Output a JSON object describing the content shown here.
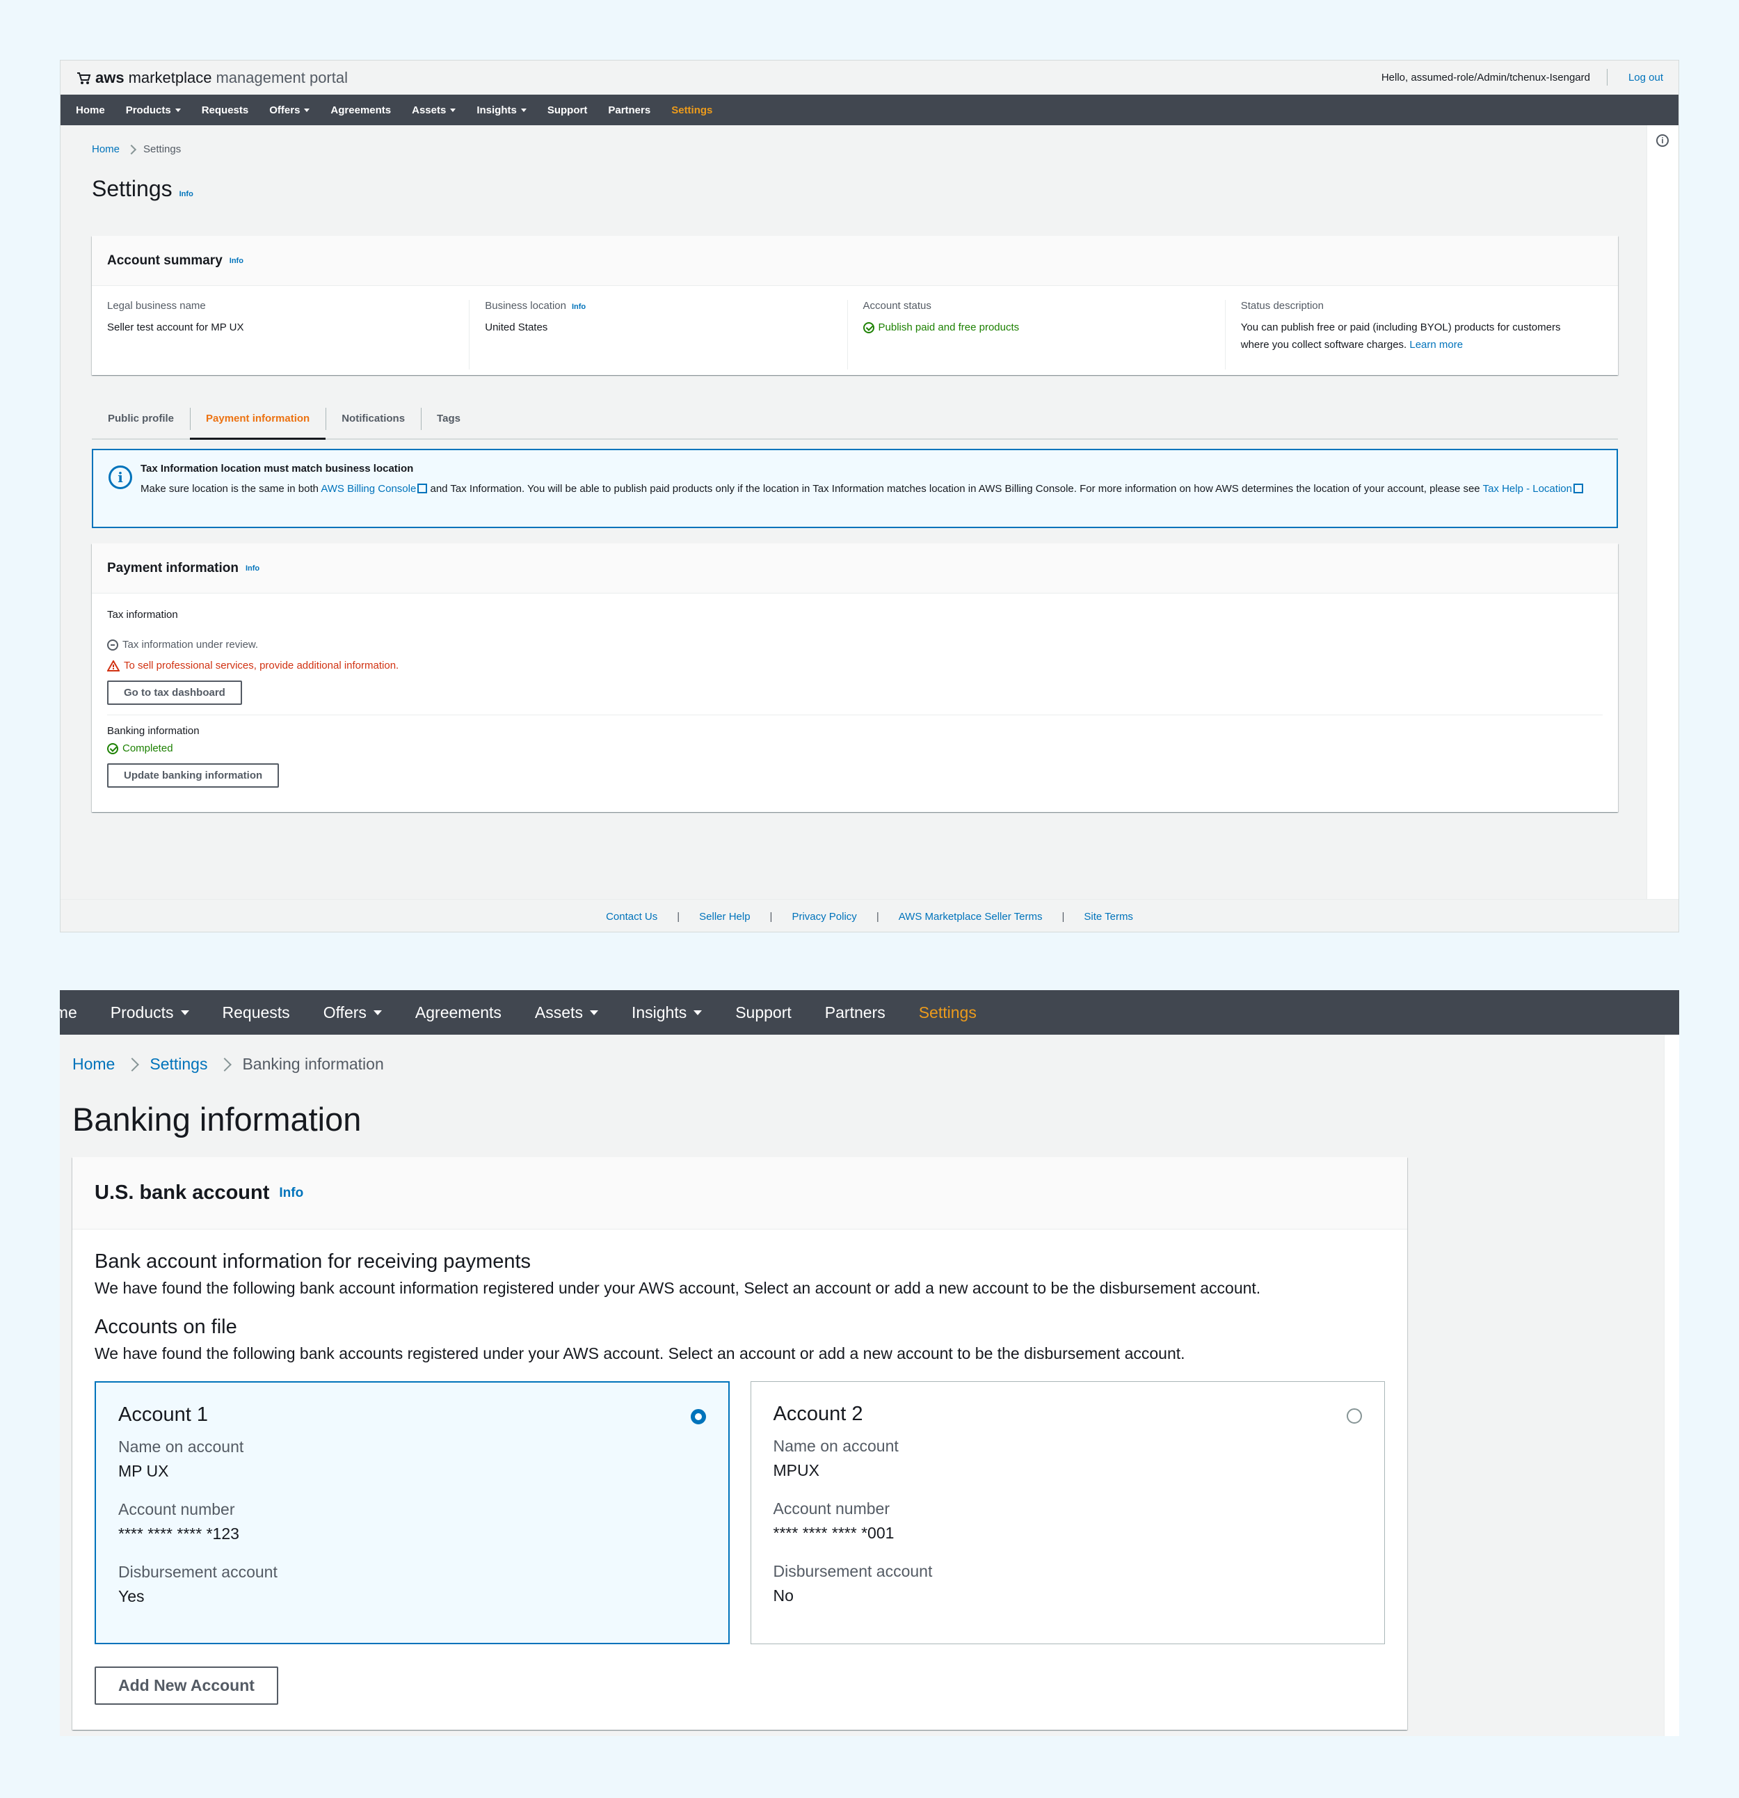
{
  "colors": {
    "link": "#0073bb",
    "nav_bg": "#414750",
    "active_nav": "#ec9b1c",
    "active_tab": "#ec7211",
    "success": "#1d8102",
    "error": "#d13212"
  },
  "portal": {
    "brand_aws": "aws",
    "brand_marketplace": "marketplace",
    "brand_rest": "management portal",
    "greeting": "Hello, assumed-role/Admin/tchenux-Isengard",
    "logout": "Log out"
  },
  "nav": {
    "items": [
      {
        "label": "Home",
        "dropdown": false
      },
      {
        "label": "Products",
        "dropdown": true
      },
      {
        "label": "Requests",
        "dropdown": false
      },
      {
        "label": "Offers",
        "dropdown": true
      },
      {
        "label": "Agreements",
        "dropdown": false
      },
      {
        "label": "Assets",
        "dropdown": true
      },
      {
        "label": "Insights",
        "dropdown": true
      },
      {
        "label": "Support",
        "dropdown": false
      },
      {
        "label": "Partners",
        "dropdown": false
      },
      {
        "label": "Settings",
        "dropdown": false,
        "active": true
      }
    ],
    "truncated_home": "ome"
  },
  "settings_page": {
    "breadcrumb": {
      "home": "Home",
      "current": "Settings"
    },
    "title": "Settings",
    "info": "Info",
    "account_summary": {
      "title": "Account summary",
      "info": "Info",
      "legal_name_label": "Legal business name",
      "legal_name_value": "Seller test account for MP UX",
      "business_location_label": "Business location",
      "business_location_info": "Info",
      "business_location_value": "United States",
      "account_status_label": "Account status",
      "account_status_value": "Publish paid and free products",
      "status_description_label": "Status description",
      "status_description_value": "You can publish free or paid (including BYOL) products for customers where you collect software charges.",
      "learn_more": "Learn more"
    },
    "tabs": [
      "Public profile",
      "Payment information",
      "Notifications",
      "Tags"
    ],
    "active_tab": "Payment information",
    "alert": {
      "title": "Tax Information location must match business location",
      "text_before_link": "Make sure location is the same in both",
      "billing_link": "AWS Billing Console",
      "text_after_link": "and Tax Information. You will be able to publish paid products only if the location in Tax Information matches location in AWS Billing Console. For more information on how AWS determines the location of your account, please see",
      "help_link": "Tax Help - Location"
    },
    "payment_info": {
      "title": "Payment information",
      "info": "Info",
      "tax_label": "Tax information",
      "tax_review": "Tax information under review.",
      "tax_warning": "To sell professional services, provide additional information.",
      "tax_button": "Go to tax dashboard",
      "banking_label": "Banking information",
      "banking_status": "Completed",
      "banking_button": "Update banking information"
    },
    "footer": [
      "Contact Us",
      "Seller Help",
      "Privacy Policy",
      "AWS Marketplace Seller Terms",
      "Site Terms"
    ],
    "footer_sep": "|"
  },
  "banking_page": {
    "breadcrumb": {
      "home": "Home",
      "settings": "Settings",
      "current": "Banking information"
    },
    "title": "Banking information",
    "card_title": "U.S. bank account",
    "info": "Info",
    "section1_title": "Bank account information for receiving payments",
    "section1_desc": "We have found the following bank account information registered under your AWS account, Select an account or add a new account to be the disbursement account.",
    "section2_title": "Accounts on file",
    "section2_desc": "We have found the following bank accounts registered under your AWS account. Select an account or add a new account to be the disbursement account.",
    "field_labels": {
      "name": "Name on account",
      "number": "Account number",
      "disbursement": "Disbursement account"
    },
    "accounts": [
      {
        "title": "Account 1",
        "name": "MP UX",
        "number": "**** **** **** *123",
        "disbursement": "Yes",
        "selected": true
      },
      {
        "title": "Account 2",
        "name": "MPUX",
        "number": "**** **** **** *001",
        "disbursement": "No",
        "selected": false
      }
    ],
    "add_button": "Add New Account"
  }
}
